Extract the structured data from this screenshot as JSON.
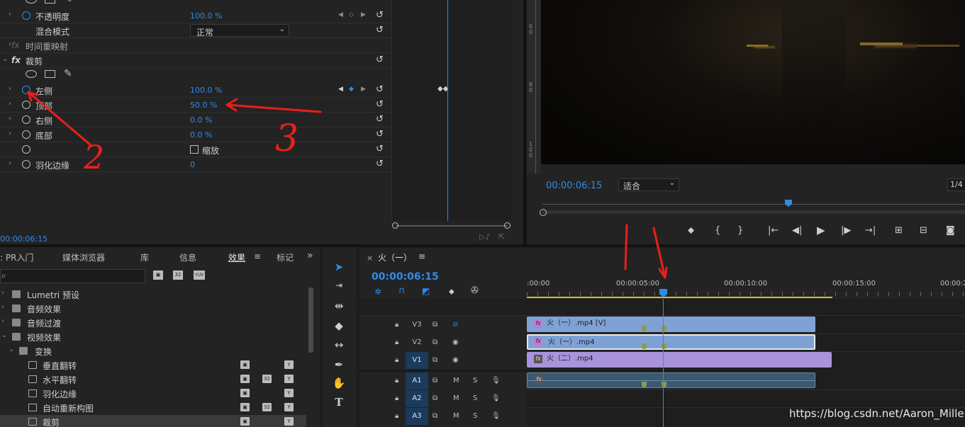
{
  "effect_controls": {
    "rows": [
      {
        "twirl": "›",
        "label": "不透明度",
        "value": "100.0",
        "unit": "%",
        "stopwatch": "on"
      },
      {
        "label": "混合模式",
        "value": "正常"
      },
      {
        "twirl": "›",
        "fx": "fx",
        "label": "时间重映射"
      },
      {
        "twirl": "⌄",
        "fx": "fx",
        "label": "裁剪"
      },
      {
        "twirl": "›",
        "label": "左侧",
        "value": "100.0",
        "unit": "%",
        "stopwatch": "on"
      },
      {
        "twirl": "›",
        "label": "顶部",
        "value": "50.0",
        "unit": "%"
      },
      {
        "twirl": "›",
        "label": "右侧",
        "value": "0.0",
        "unit": "%"
      },
      {
        "twirl": "›",
        "label": "底部",
        "value": "0.0",
        "unit": "%"
      },
      {
        "label": "缩放",
        "checkbox": true
      },
      {
        "twirl": "›",
        "label": "羽化边缘",
        "value": "0"
      }
    ],
    "timecode": "00:00:06:15"
  },
  "program_monitor": {
    "timecode": "00:00:06:15",
    "fit_option": "适合",
    "resolution": "1/4"
  },
  "project_panel": {
    "tabs": [
      "PR入门",
      "媒体浏览器",
      "库",
      "信息",
      "效果",
      "标记"
    ],
    "active_tab": "效果",
    "tree": [
      {
        "label": "Lumetri 预设",
        "level": 0
      },
      {
        "label": "音频效果",
        "level": 0
      },
      {
        "label": "音频过渡",
        "level": 0
      },
      {
        "label": "视频效果",
        "level": 0
      },
      {
        "label": "变换",
        "level": 1
      },
      {
        "label": "垂直翻转",
        "level": 2
      },
      {
        "label": "水平翻转",
        "level": 2
      },
      {
        "label": "羽化边缘",
        "level": 2
      },
      {
        "label": "自动重新构图",
        "level": 2
      },
      {
        "label": "裁剪",
        "level": 2
      }
    ]
  },
  "timeline": {
    "sequence_name": "火（一）",
    "timecode": "00:00:06:15",
    "ruler": [
      ":00:00",
      "00:00:05:00",
      "00:00:10:00",
      "00:00:15:00",
      "00:00:2"
    ],
    "tracks": [
      {
        "name": "V3",
        "active": false
      },
      {
        "name": "V2",
        "active": false
      },
      {
        "name": "V1",
        "active": true
      },
      {
        "name": "A1",
        "active": true
      },
      {
        "name": "A2",
        "active": true
      },
      {
        "name": "A3",
        "active": true
      }
    ],
    "clips": {
      "v3": "火（一）.mp4 [V]",
      "v2": "火（一）.mp4",
      "v1": "火（二）.mp4"
    }
  },
  "annotations": {
    "two": "2",
    "three": "3"
  },
  "watermark": "https://blog.csdn.net/Aaron_Miller"
}
